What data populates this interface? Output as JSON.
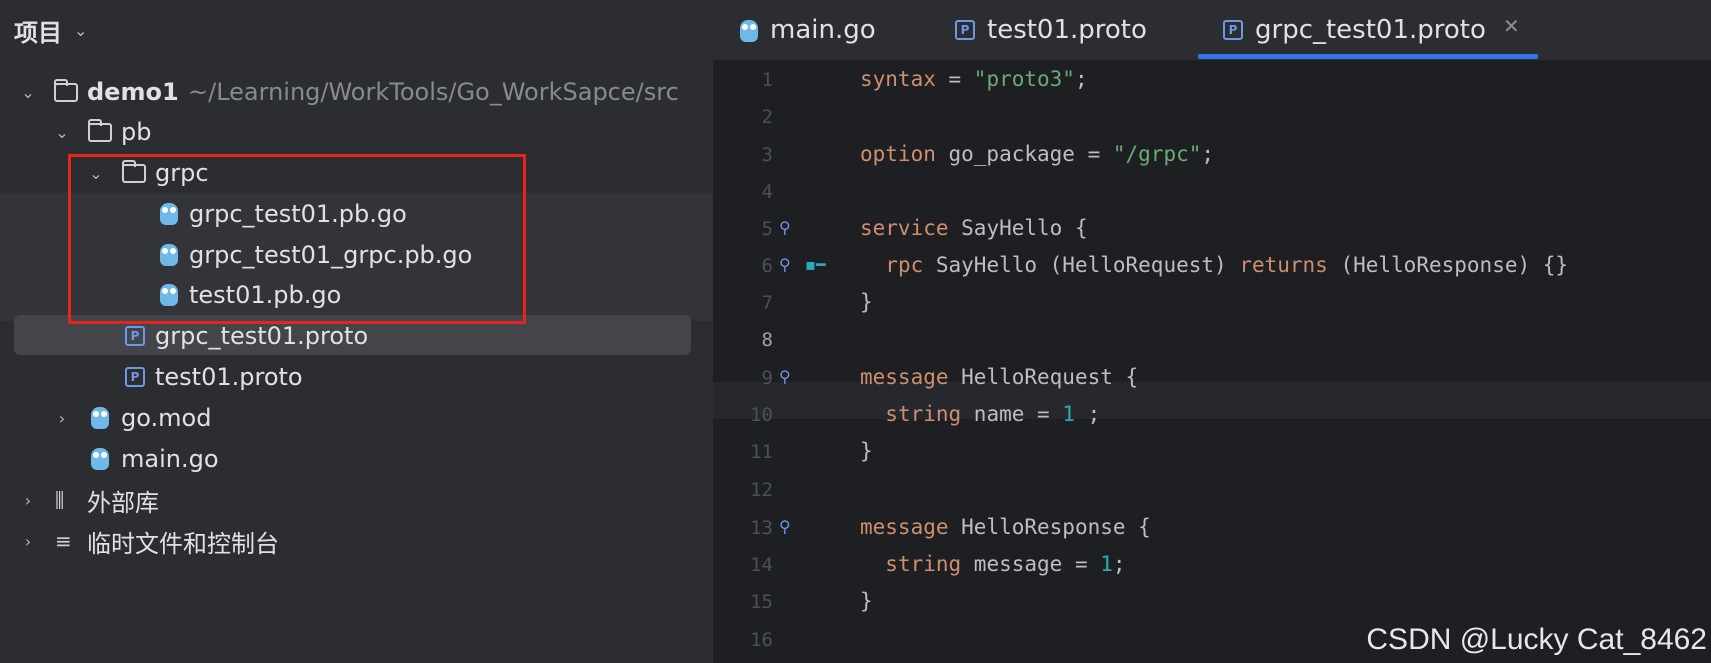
{
  "project": {
    "title": "项目",
    "tree": [
      {
        "label": "demo1",
        "path": "~/Learning/WorkTools/Go_WorkSapce/src"
      },
      {
        "label": "pb"
      },
      {
        "label": "grpc"
      },
      {
        "label": "grpc_test01.pb.go"
      },
      {
        "label": "grpc_test01_grpc.pb.go"
      },
      {
        "label": "test01.pb.go"
      },
      {
        "label": "grpc_test01.proto"
      },
      {
        "label": "test01.proto"
      },
      {
        "label": "go.mod"
      },
      {
        "label": "main.go"
      },
      {
        "label": "外部库"
      },
      {
        "label": "临时文件和控制台"
      }
    ]
  },
  "tabs": [
    {
      "label": "main.go",
      "icon": "gopher-icon"
    },
    {
      "label": "test01.proto",
      "icon": "proto-icon"
    },
    {
      "label": "grpc_test01.proto",
      "icon": "proto-icon",
      "active": true
    }
  ],
  "editor": {
    "lines": [
      {
        "n": "1"
      },
      {
        "n": "2"
      },
      {
        "n": "3"
      },
      {
        "n": "4"
      },
      {
        "n": "5"
      },
      {
        "n": "6"
      },
      {
        "n": "7"
      },
      {
        "n": "8"
      },
      {
        "n": "9"
      },
      {
        "n": "10"
      },
      {
        "n": "11"
      },
      {
        "n": "12"
      },
      {
        "n": "13"
      },
      {
        "n": "14"
      },
      {
        "n": "15"
      },
      {
        "n": "16"
      }
    ],
    "code": {
      "l1": {
        "a": "syntax",
        "b": " = ",
        "c": "\"proto3\"",
        "d": ";"
      },
      "l3": {
        "a": "option",
        "b": " go_package = ",
        "c": "\"/grpc\"",
        "d": ";"
      },
      "l5": {
        "a": "service",
        "b": " SayHello {"
      },
      "l6": {
        "a": "  ",
        "b": "rpc",
        "c": " SayHello (HelloRequest) ",
        "d": "returns",
        "e": " (HelloResponse) {}"
      },
      "l7": {
        "a": "}"
      },
      "l9": {
        "a": "message",
        "b": " HelloRequest {"
      },
      "l10": {
        "a": "  ",
        "b": "string",
        "c": " name = ",
        "d": "1",
        "e": " ;"
      },
      "l11": {
        "a": "}"
      },
      "l13": {
        "a": "message",
        "b": " HelloResponse {"
      },
      "l14": {
        "a": "  ",
        "b": "string",
        "c": " message = ",
        "d": "1",
        "e": ";"
      },
      "l15": {
        "a": "}"
      }
    },
    "current_line": "8"
  },
  "watermark": "CSDN @Lucky Cat_8462",
  "colors": {
    "keyword": "#cf8e6d",
    "string": "#6aab73",
    "number": "#2aacb8",
    "highlight_box": "#e6241e",
    "tab_underline": "#3574f0"
  }
}
